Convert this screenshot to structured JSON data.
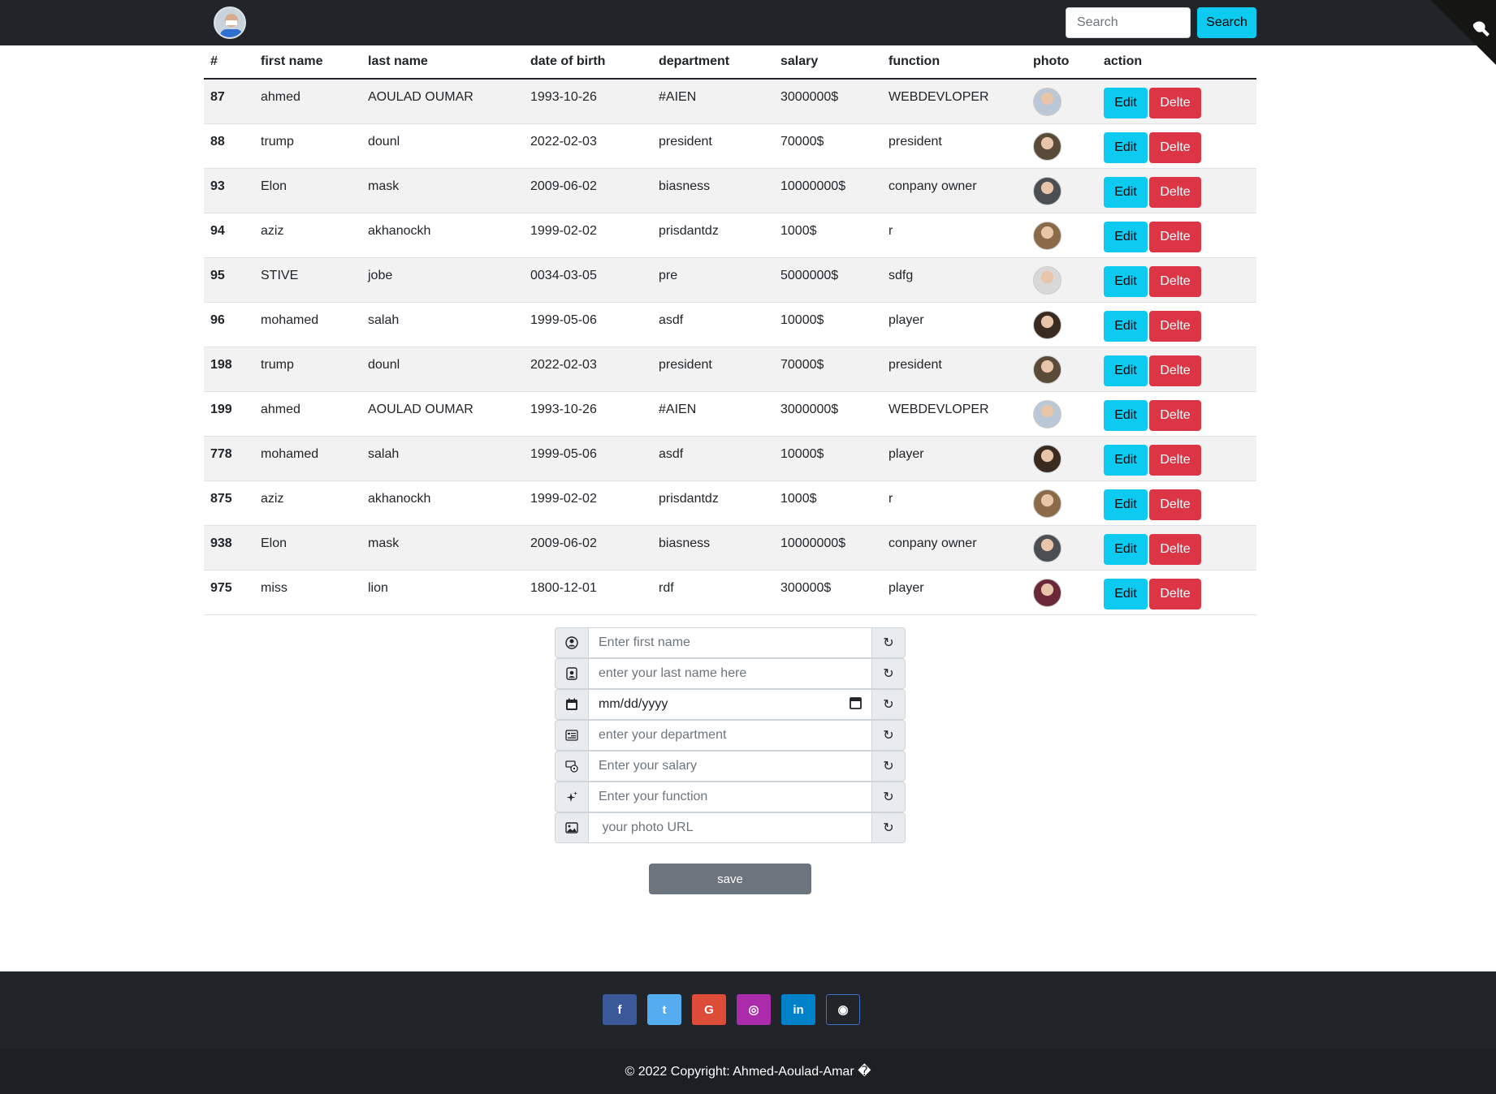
{
  "navbar": {
    "search_placeholder": "Search",
    "search_button": "Search"
  },
  "table": {
    "headers": [
      "#",
      "first name",
      "last name",
      "date of birth",
      "department",
      "salary",
      "function",
      "photo",
      "action"
    ],
    "rows": [
      {
        "id": "87",
        "first": "ahmed",
        "last": "AOULAD OUMAR",
        "dob": "1993-10-26",
        "dept": "#AIEN",
        "salary": "3000000$",
        "func": "WEBDEVLOPER",
        "photo_color": "#b9c7d6"
      },
      {
        "id": "88",
        "first": "trump",
        "last": "dounl",
        "dob": "2022-02-03",
        "dept": "president",
        "salary": "70000$",
        "func": "president",
        "photo_color": "#5a4a3a"
      },
      {
        "id": "93",
        "first": "Elon",
        "last": "mask",
        "dob": "2009-06-02",
        "dept": "biasness",
        "salary": "10000000$",
        "func": "conpany owner",
        "photo_color": "#4b4f54"
      },
      {
        "id": "94",
        "first": "aziz",
        "last": "akhanockh",
        "dob": "1999-02-02",
        "dept": "prisdantdz",
        "salary": "1000$",
        "func": "r",
        "photo_color": "#8a6a48"
      },
      {
        "id": "95",
        "first": "STIVE",
        "last": "jobe",
        "dob": "0034-03-05",
        "dept": "pre",
        "salary": "5000000$",
        "func": "sdfg",
        "photo_color": "#d8d8d8"
      },
      {
        "id": "96",
        "first": "mohamed",
        "last": "salah",
        "dob": "1999-05-06",
        "dept": "asdf",
        "salary": "10000$",
        "func": "player",
        "photo_color": "#3a2b20"
      },
      {
        "id": "198",
        "first": "trump",
        "last": "dounl",
        "dob": "2022-02-03",
        "dept": "president",
        "salary": "70000$",
        "func": "president",
        "photo_color": "#5a4a3a"
      },
      {
        "id": "199",
        "first": "ahmed",
        "last": "AOULAD OUMAR",
        "dob": "1993-10-26",
        "dept": "#AIEN",
        "salary": "3000000$",
        "func": "WEBDEVLOPER",
        "photo_color": "#b9c7d6"
      },
      {
        "id": "778",
        "first": "mohamed",
        "last": "salah",
        "dob": "1999-05-06",
        "dept": "asdf",
        "salary": "10000$",
        "func": "player",
        "photo_color": "#3a2b20"
      },
      {
        "id": "875",
        "first": "aziz",
        "last": "akhanockh",
        "dob": "1999-02-02",
        "dept": "prisdantdz",
        "salary": "1000$",
        "func": "r",
        "photo_color": "#8a6a48"
      },
      {
        "id": "938",
        "first": "Elon",
        "last": "mask",
        "dob": "2009-06-02",
        "dept": "biasness",
        "salary": "10000000$",
        "func": "conpany owner",
        "photo_color": "#4b4f54"
      },
      {
        "id": "975",
        "first": "miss",
        "last": "lion",
        "dob": "1800-12-01",
        "dept": "rdf",
        "salary": "300000$",
        "func": "player",
        "photo_color": "#6a2838"
      }
    ],
    "edit_label": "Edit",
    "delete_label": "Delte"
  },
  "form": {
    "first_name_placeholder": "Enter first name",
    "last_name_placeholder": "enter your last name here",
    "dob_value": "mm/dd/yyyy",
    "department_placeholder": "enter your department",
    "salary_placeholder": "Enter your salary",
    "function_placeholder": "Enter your function",
    "photo_placeholder": " your photo URL",
    "save_label": "save"
  },
  "footer": {
    "social": [
      {
        "name": "facebook",
        "glyph": "f",
        "color": "#3b5998"
      },
      {
        "name": "twitter",
        "glyph": "t",
        "color": "#55acee"
      },
      {
        "name": "google",
        "glyph": "G",
        "color": "#dd4b39"
      },
      {
        "name": "instagram",
        "glyph": "◎",
        "color": "#ac2bac"
      },
      {
        "name": "linkedin",
        "glyph": "in",
        "color": "#0082ca"
      },
      {
        "name": "github",
        "glyph": "◉",
        "color": "#212529"
      }
    ],
    "copyright": "© 2022 Copyright: Ahmed-Aoulad-Amar �"
  }
}
